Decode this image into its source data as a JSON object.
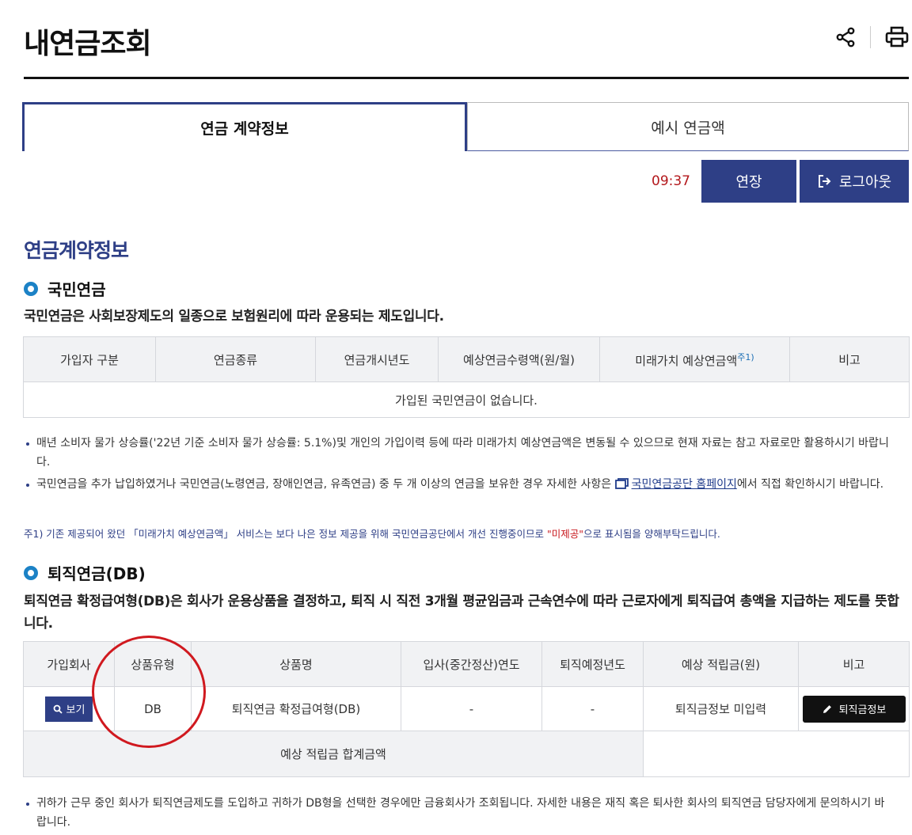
{
  "page": {
    "title": "내연금조회"
  },
  "icons": {
    "share": "share-icon",
    "print": "print-icon",
    "logout": "logout-icon",
    "search": "search-icon",
    "pencil": "pencil-icon",
    "external": "external-link-icon"
  },
  "tabs": [
    {
      "label": "연금 계약정보",
      "active": true
    },
    {
      "label": "예시 연금액",
      "active": false
    }
  ],
  "session": {
    "timer": "09:37",
    "extend_label": "연장",
    "logout_label": "로그아웃"
  },
  "colors": {
    "accent": "#2e3f86",
    "timer": "#b3171b",
    "dot": "#1c82c6",
    "annotation": "#d0191f"
  },
  "section": {
    "title": "연금계약정보"
  },
  "national": {
    "title": "국민연금",
    "desc": "국민연금은 사회보장제도의 일종으로 보험원리에 따라 운용되는 제도입니다.",
    "headers": [
      "가입자 구분",
      "연금종류",
      "연금개시년도",
      "예상연금수령액(원/월)",
      "미래가치 예상연금액",
      "비고"
    ],
    "footnote_mark": "주1)",
    "empty": "가입된 국민연금이 없습니다.",
    "notes": [
      "매년 소비자 물가 상승률('22년 기준 소비자 물가 상승률: 5.1%)및 개인의 가입이력 등에 따라 미래가치 예상연금액은 변동될 수 있으므로 현재 자료는 참고 자료로만 활용하시기 바랍니다.",
      {
        "before": "국민연금을 추가 납입하였거나 국민연금(노령연금, 장애인연금, 유족연금) 중 두 개 이상의 연금을 보유한 경우 자세한 사항은",
        "link": "국민연금공단 홈페이지",
        "after": "에서 직접 확인하시기 바랍니다."
      }
    ],
    "footnote": {
      "before": "주1) 기존 제공되어 왔던 「미래가치 예상연금액」 서비스는 보다 나은 정보 제공을 위해 국민연금공단에서 개선 진행중이므로",
      "highlight": "\"미제공\"",
      "after": "으로 표시됨을 양해부탁드립니다."
    }
  },
  "retirement": {
    "title": "퇴직연금(DB)",
    "desc": "퇴직연금 확정급여형(DB)은 회사가 운용상품을 결정하고, 퇴직 시 직전 3개월 평균임금과 근속연수에 따라 근로자에게 퇴직급여 총액을 지급하는 제도를 뜻합니다.",
    "headers": [
      "가입회사",
      "상품유형",
      "상품명",
      "입사(중간정산)연도",
      "퇴직예정년도",
      "예상 적립금(원)",
      "비고"
    ],
    "row": {
      "view_label": "보기",
      "type": "DB",
      "product": "퇴직연금 확정급여형(DB)",
      "join_year": "-",
      "retire_year": "-",
      "amount": "퇴직금정보 미입력",
      "action_label": "퇴직금정보"
    },
    "total_label": "예상 적립금 합계금액",
    "total_value": "",
    "note": "귀하가 근무 중인 회사가 퇴직연금제도를 도입하고 귀하가 DB형을 선택한 경우에만 금융회사가 조회됩니다. 자세한 내용은 재직 혹은 퇴사한 회사의 퇴직연금 담당자에게 문의하시기 바랍니다."
  }
}
